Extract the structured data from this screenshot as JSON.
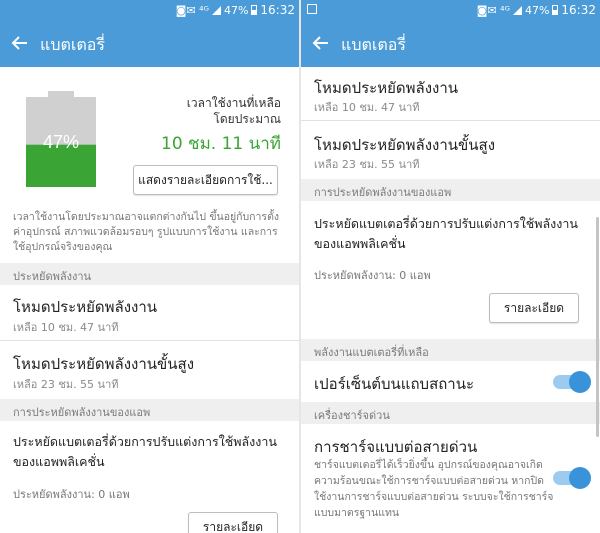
{
  "status": {
    "icons": "◙✉ ⁴ᴳ",
    "battery": "47%",
    "time": "16:32"
  },
  "header": {
    "title": "แบตเตอรี่"
  },
  "left": {
    "battery_percent": "47%",
    "battery_level": 0.47,
    "remaining_label": "เวลาใช้งานที่เหลือ",
    "estimate_label": "โดยประมาณ",
    "remaining_time": "10 ชม. 11 นาที",
    "details_button": "แสดงรายละเอียดการใช้...",
    "note": "เวลาใช้งานโดยประมาณอาจแตกต่างกันไป ขึ้นอยู่กับการตั้งค่าอุปกรณ์ สภาพแวดล้อมรอบๆ รูปแบบการใช้งาน และการใช้อุปกรณ์จริงของคุณ",
    "power_saving_header": "ประหยัดพลังงาน",
    "power_saving_mode": {
      "title": "โหมดประหยัดพลังงาน",
      "sub": "เหลือ 10 ชม. 47 นาที"
    },
    "ultra_power_saving_mode": {
      "title": "โหมดประหยัดพลังงานขั้นสูง",
      "sub": "เหลือ 23 ชม. 55 นาที"
    },
    "app_power_header": "การประหยัดพลังงานของแอพ",
    "app_power_desc": "ประหยัดแบตเตอรี่ด้วยการปรับแต่งการใช้พลังงานของแอพพลิเคชั่น",
    "app_power_saved": "ประหยัดพลังงาน: 0 แอพ",
    "details_btn": "รายละเอียด"
  },
  "right": {
    "power_saving_mode": {
      "title": "โหมดประหยัดพลังงาน",
      "sub": "เหลือ 10 ชม. 47 นาที"
    },
    "ultra_power_saving_mode": {
      "title": "โหมดประหยัดพลังงานขั้นสูง",
      "sub": "เหลือ 23 ชม. 55 นาที"
    },
    "app_power_header": "การประหยัดพลังงานของแอพ",
    "app_power_desc": "ประหยัดแบตเตอรี่ด้วยการปรับแต่งการใช้พลังงานของแอพพลิเคชั่น",
    "app_power_saved": "ประหยัดพลังงาน: 0 แอพ",
    "details_btn": "รายละเอียด",
    "remaining_header": "พลังงานแบตเตอรี่ที่เหลือ",
    "percent_status_bar": "เปอร์เซ็นต์บนแถบสถานะ",
    "fast_charge_header": "เครื่องชาร์จด่วน",
    "fast_cable_charging": {
      "title": "การชาร์จแบบต่อสายด่วน",
      "desc": "ชาร์จแบตเตอรี่ได้เร็วยิ่งขึ้น อุปกรณ์ของคุณอาจเกิดความร้อนขณะใช้การชาร์จแบบต่อสายด่วน หากปิดใช้งานการชาร์จแบบต่อสายด่วน ระบบจะใช้การชาร์จแบบมาตรฐานแทน"
    }
  },
  "colors": {
    "accent": "#4a9bd8",
    "green": "#3aa535",
    "toggle": "#3a93d8"
  }
}
